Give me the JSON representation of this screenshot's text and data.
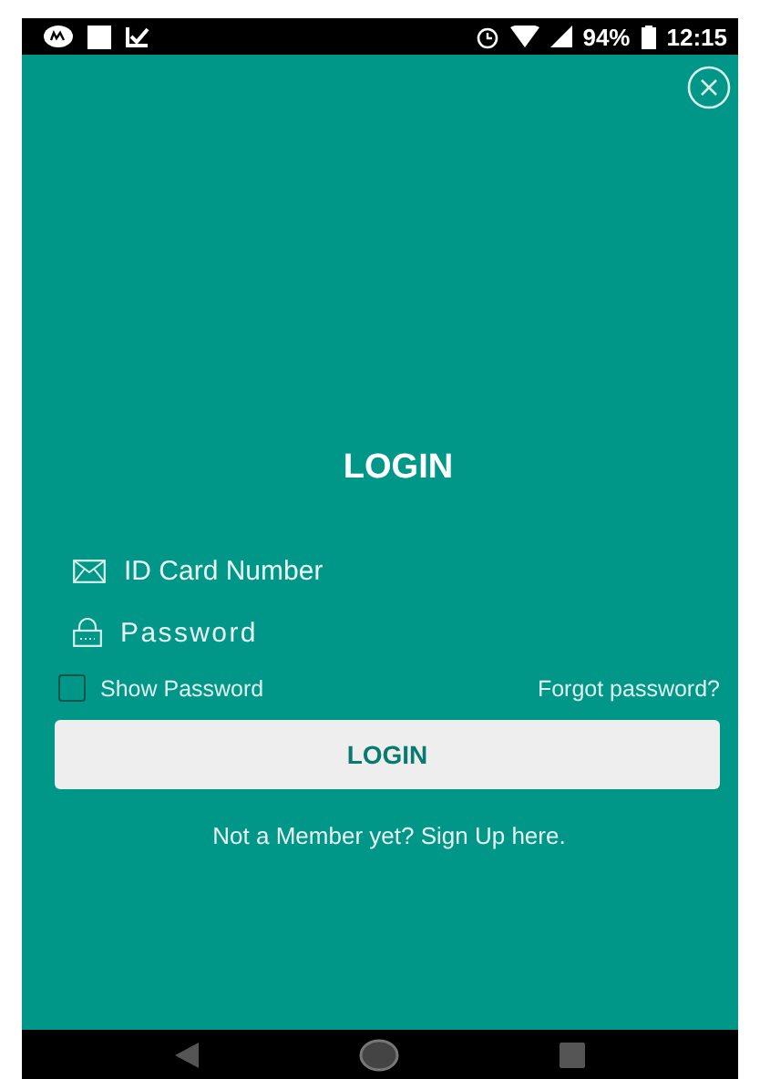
{
  "status_bar": {
    "battery": "94%",
    "time": "12:15"
  },
  "title": "LOGIN",
  "fields": [
    {
      "kind": "id",
      "placeholder": "ID Card Number"
    },
    {
      "kind": "password",
      "placeholder": "Password"
    }
  ],
  "show_password": {
    "label": "Show Password",
    "checked": false
  },
  "forgot_link": "Forgot password?",
  "login_button": "LOGIN",
  "signup_link": "Not a Member yet? Sign Up here."
}
